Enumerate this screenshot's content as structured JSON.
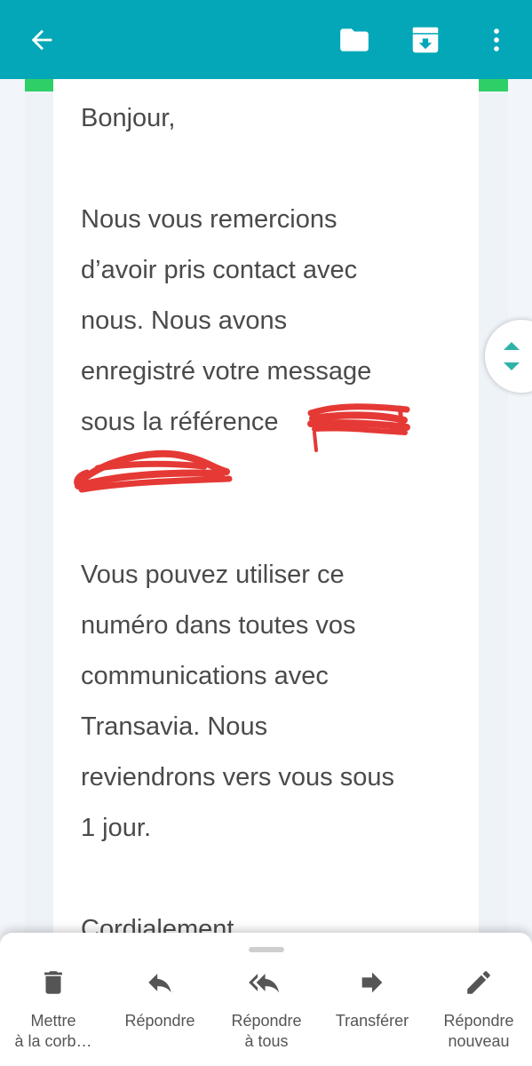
{
  "toolbar": {
    "back_icon": "arrow-left-icon",
    "folder_icon": "folder-icon",
    "archive_icon": "archive-icon",
    "more_icon": "more-vertical-icon",
    "color": "#04a7b8"
  },
  "email": {
    "greeting": "Bonjour,",
    "para1": [
      "Nous vous remercions",
      "d’avoir pris contact avec",
      "nous. Nous avons",
      "enregistré votre message",
      "sous la référence"
    ],
    "para2": [
      "Vous pouvez utiliser ce",
      "numéro dans toutes vos",
      "communications avec",
      "Transavia. Nous",
      "reviendrons vers vous sous",
      "1 jour."
    ],
    "closing": "Cordialement,",
    "redaction_color": "#e53935"
  },
  "actions": [
    {
      "label_line1": "Mettre",
      "label_line2": "à la corb…",
      "icon": "trash-icon"
    },
    {
      "label_line1": "Répondre",
      "label_line2": "",
      "icon": "reply-icon"
    },
    {
      "label_line1": "Répondre",
      "label_line2": "à tous",
      "icon": "reply-all-icon"
    },
    {
      "label_line1": "Transférer",
      "label_line2": "",
      "icon": "forward-icon"
    },
    {
      "label_line1": "Répondre",
      "label_line2": "nouveau",
      "icon": "edit-icon"
    }
  ],
  "scroll_handle": {
    "icon": "scroll-up-down-icon",
    "color": "#2fb3a9"
  }
}
